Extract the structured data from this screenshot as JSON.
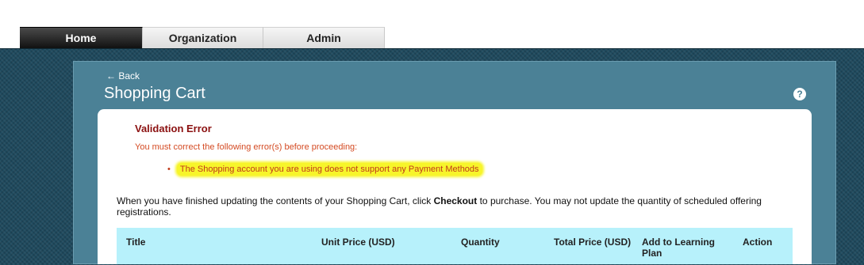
{
  "nav": {
    "tabs": [
      {
        "label": "Home",
        "active": true
      },
      {
        "label": "Organization",
        "active": false
      },
      {
        "label": "Admin",
        "active": false
      }
    ]
  },
  "header": {
    "back_label": "← Back",
    "title": "Shopping Cart",
    "help_icon": "question-circle-icon"
  },
  "validation": {
    "title": "Validation Error",
    "message": "You must correct the following error(s) before proceeding:",
    "bullet": "•",
    "errors": [
      "The Shopping account you are using does not support any Payment Methods"
    ]
  },
  "instructions": {
    "before": "When you have finished updating the contents of your Shopping Cart, click ",
    "bold": "Checkout",
    "after": " to purchase. You may not update the quantity of scheduled offering registrations."
  },
  "table": {
    "columns": [
      "Title",
      "Unit Price (USD)",
      "Quantity",
      "Total Price (USD)",
      "Add to Learning Plan",
      "Action"
    ]
  },
  "colors": {
    "accent": "#b7f1fb",
    "error_title": "#8b1010",
    "error_text": "#d44a22",
    "highlight": "#f7f52a"
  }
}
